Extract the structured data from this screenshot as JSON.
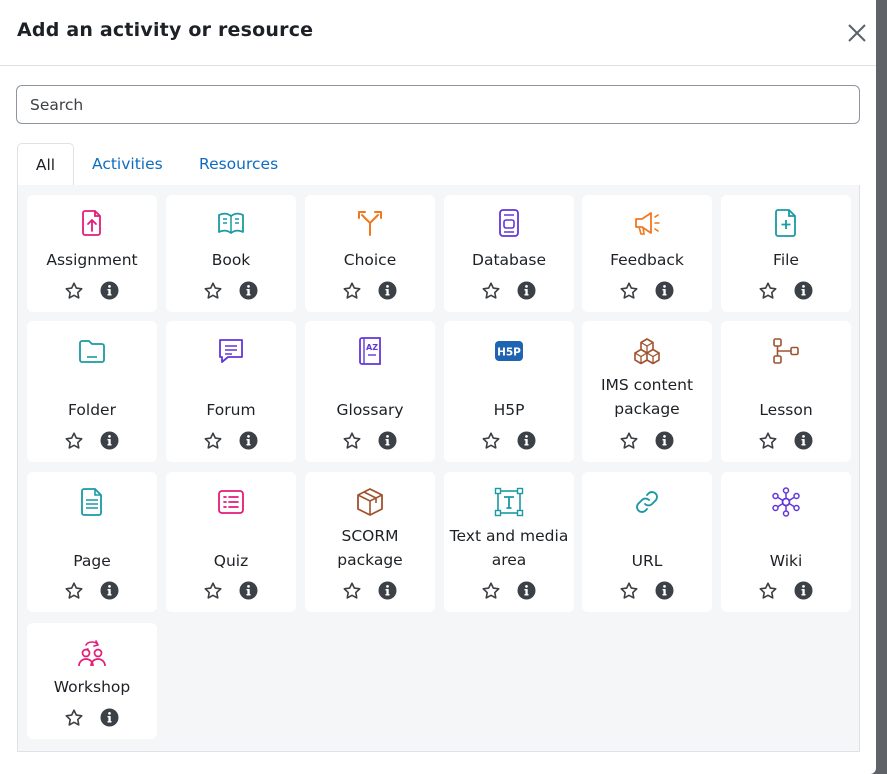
{
  "modal": {
    "title": "Add an activity or resource",
    "search_placeholder": "Search",
    "tabs": [
      "All",
      "Activities",
      "Resources"
    ]
  },
  "modules": [
    {
      "name": "Assignment",
      "icon": "assignment-icon",
      "color": "#e31c78"
    },
    {
      "name": "Book",
      "icon": "book-icon",
      "color": "#1a9aa2"
    },
    {
      "name": "Choice",
      "icon": "choice-icon",
      "color": "#f0781e"
    },
    {
      "name": "Database",
      "icon": "database-icon",
      "color": "#6236db"
    },
    {
      "name": "Feedback",
      "icon": "feedback-icon",
      "color": "#f0781e"
    },
    {
      "name": "File",
      "icon": "file-icon",
      "color": "#1a9aa2"
    },
    {
      "name": "Folder",
      "icon": "folder-icon",
      "color": "#1a9aa2"
    },
    {
      "name": "Forum",
      "icon": "forum-icon",
      "color": "#6236db"
    },
    {
      "name": "Glossary",
      "icon": "glossary-icon",
      "color": "#6236db"
    },
    {
      "name": "H5P",
      "icon": "h5p-icon",
      "color": "#1f64b3"
    },
    {
      "name": "IMS content package",
      "icon": "ims-package-icon",
      "color": "#a0522d"
    },
    {
      "name": "Lesson",
      "icon": "lesson-icon",
      "color": "#a0522d"
    },
    {
      "name": "Page",
      "icon": "page-icon",
      "color": "#1a9aa2"
    },
    {
      "name": "Quiz",
      "icon": "quiz-icon",
      "color": "#e31c78"
    },
    {
      "name": "SCORM package",
      "icon": "scorm-icon",
      "color": "#a0522d"
    },
    {
      "name": "Text and media area",
      "icon": "text-media-icon",
      "color": "#1a9aa2"
    },
    {
      "name": "URL",
      "icon": "url-icon",
      "color": "#1a9aa2"
    },
    {
      "name": "Wiki",
      "icon": "wiki-icon",
      "color": "#6236db"
    },
    {
      "name": "Workshop",
      "icon": "workshop-icon",
      "color": "#e31c78"
    }
  ]
}
